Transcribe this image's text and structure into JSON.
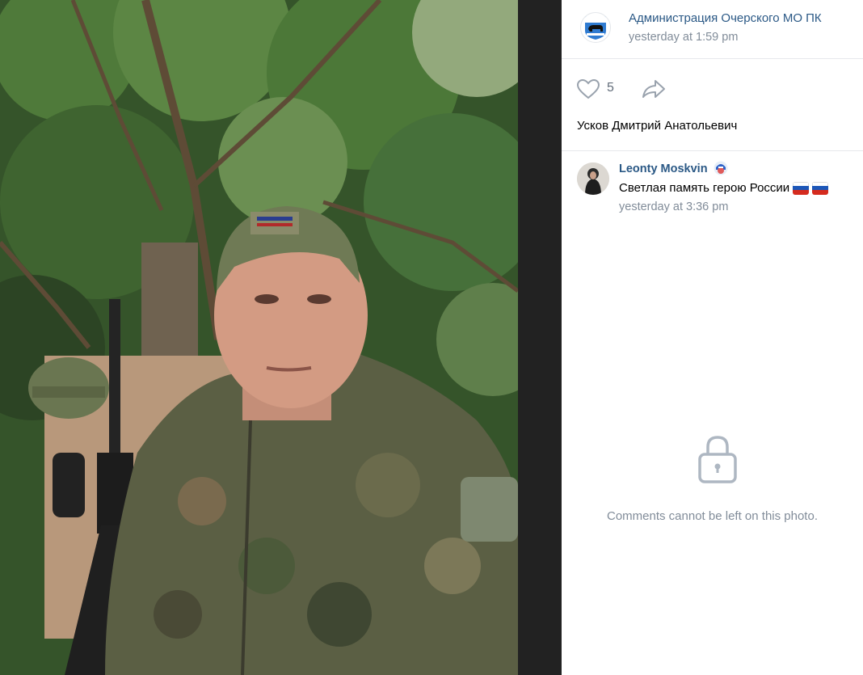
{
  "photo": {
    "description_icon": "soldier-selfie-photo"
  },
  "post": {
    "owner_name": "Администрация Очерского МО ПК",
    "owner_time": "yesterday at 1:59 pm",
    "owner_avatar_icon": "bear-coat-of-arms-icon",
    "likes_count": "5",
    "caption": "Усков Дмитрий Анатольевич"
  },
  "comment": {
    "author": "Leonty Moskvin",
    "badge_icon": "verified-badge-icon",
    "text": "Светлая память герою России",
    "time": "yesterday at 3:36 pm"
  },
  "comments_locked": {
    "message": "Comments cannot be left on this photo."
  },
  "colors": {
    "link": "#2a5885",
    "muted": "#818c99",
    "divider": "#e7e8ec"
  }
}
